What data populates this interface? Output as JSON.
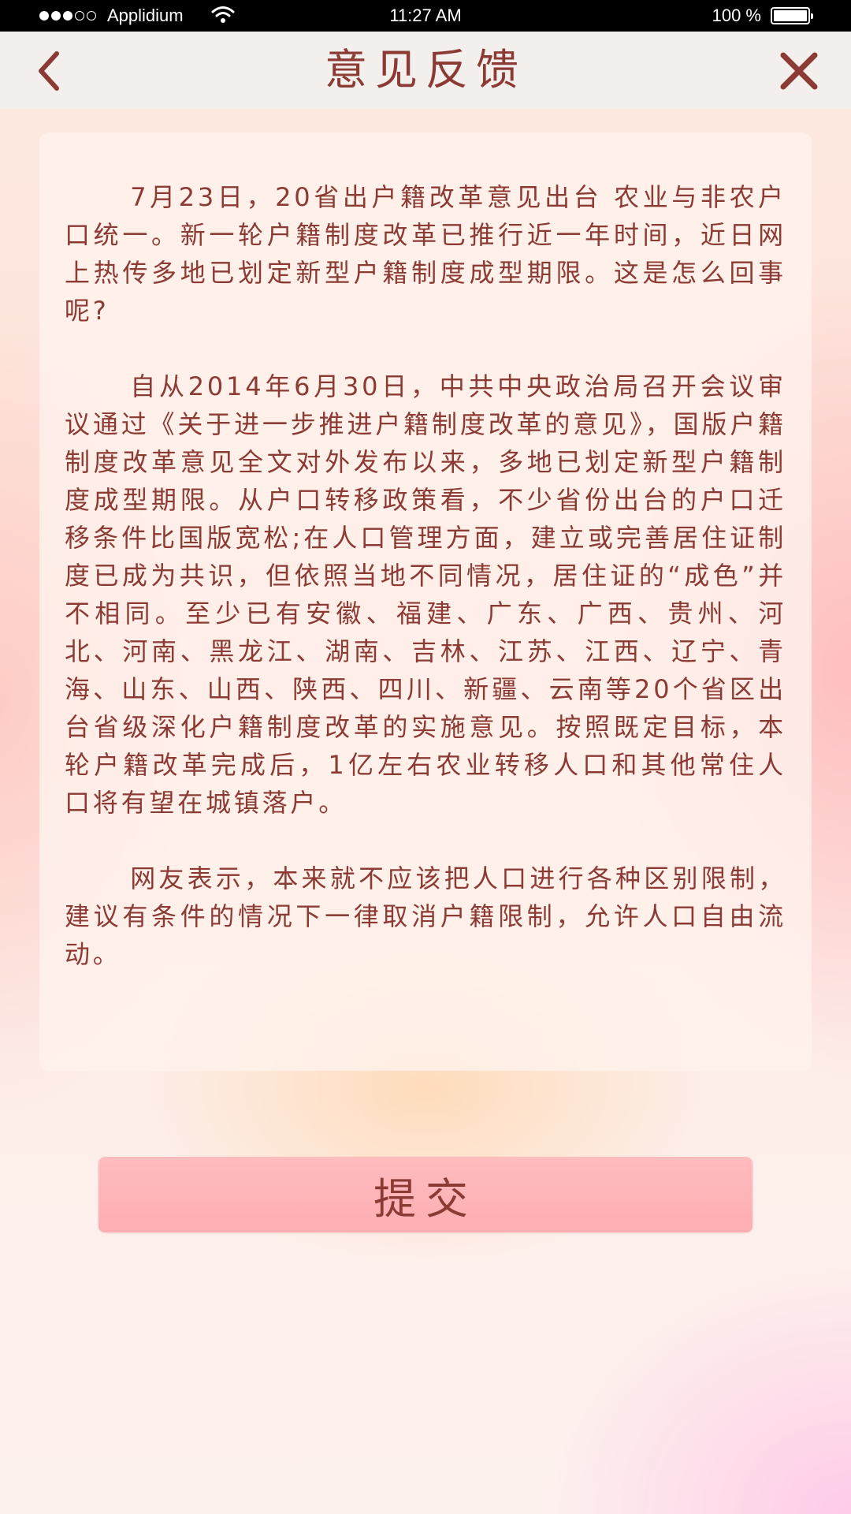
{
  "status_bar": {
    "carrier": "Applidium",
    "time": "11:27 AM",
    "battery": "100 %",
    "signal_bars_filled": 3,
    "signal_bars_total": 5
  },
  "nav": {
    "title": "意见反馈",
    "back_icon": "chevron-left-icon",
    "close_icon": "close-icon",
    "accent_color": "#8b3a34"
  },
  "article": {
    "paragraphs": [
      "7月23日，20省出户籍改革意见出台 农业与非农户口统一。新一轮户籍制度改革已推行近一年时间，近日网上热传多地已划定新型户籍制度成型期限。这是怎么回事呢?",
      "自从2014年6月30日，中共中央政治局召开会议审议通过《关于进一步推进户籍制度改革的意见》，国版户籍制度改革意见全文对外发布以来，多地已划定新型户籍制度成型期限。从户口转移政策看，不少省份出台的户口迁移条件比国版宽松;在人口管理方面，建立或完善居住证制度已成为共识，但依照当地不同情况，居住证的“成色”并不相同。至少已有安徽、福建、广东、广西、贵州、河北、河南、黑龙江、湖南、吉林、江苏、江西、辽宁、青海、山东、山西、陕西、四川、新疆、云南等20个省区出台省级深化户籍制度改革的实施意见。按照既定目标，本轮户籍改革完成后，1亿左右农业转移人口和其他常住人口将有望在城镇落户。",
      "网友表示，本来就不应该把人口进行各种区别限制，建议有条件的情况下一律取消户籍限制，允许人口自由流动。"
    ]
  },
  "submit": {
    "label": "提交",
    "color": "#fdb0b4"
  }
}
